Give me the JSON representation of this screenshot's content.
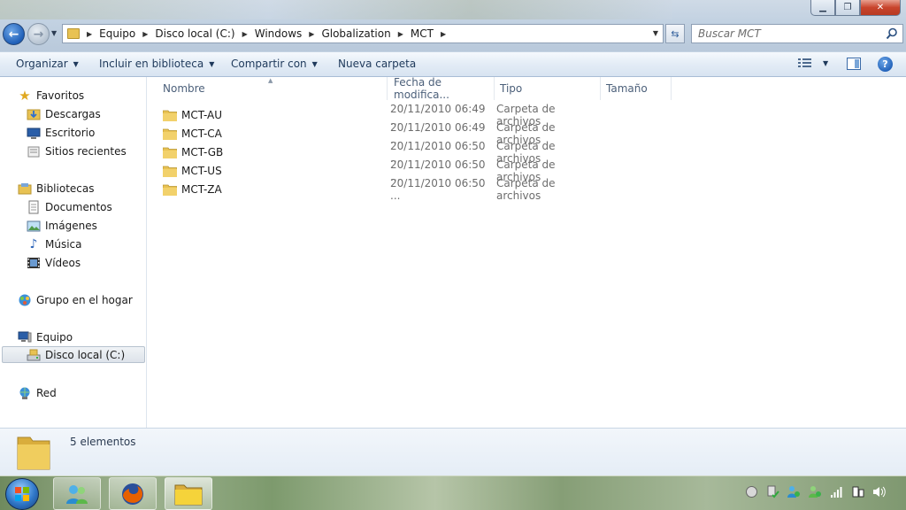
{
  "address_bar": {
    "crumbs": [
      "Equipo",
      "Disco local (C:)",
      "Windows",
      "Globalization",
      "MCT"
    ]
  },
  "search": {
    "placeholder": "Buscar MCT"
  },
  "toolbar": {
    "organize": "Organizar",
    "include_library": "Incluir en biblioteca",
    "share_with": "Compartir con",
    "new_folder": "Nueva carpeta"
  },
  "nav": {
    "favorites": "Favoritos",
    "downloads": "Descargas",
    "desktop": "Escritorio",
    "recent": "Sitios recientes",
    "libraries": "Bibliotecas",
    "documents": "Documentos",
    "images": "Imágenes",
    "music": "Música",
    "videos": "Vídeos",
    "homegroup": "Grupo en el hogar",
    "computer": "Equipo",
    "local_disk": "Disco local (C:)",
    "network": "Red"
  },
  "columns": {
    "name": "Nombre",
    "date": "Fecha de modifica...",
    "type": "Tipo",
    "size": "Tamaño"
  },
  "files": [
    {
      "name": "MCT-AU",
      "date": "20/11/2010 06:49 ...",
      "type": "Carpeta de archivos"
    },
    {
      "name": "MCT-CA",
      "date": "20/11/2010 06:49 ...",
      "type": "Carpeta de archivos"
    },
    {
      "name": "MCT-GB",
      "date": "20/11/2010 06:50 ...",
      "type": "Carpeta de archivos"
    },
    {
      "name": "MCT-US",
      "date": "20/11/2010 06:50 ...",
      "type": "Carpeta de archivos"
    },
    {
      "name": "MCT-ZA",
      "date": "20/11/2010 06:50 ...",
      "type": "Carpeta de archivos"
    }
  ],
  "details": {
    "count": "5 elementos"
  },
  "colors": {
    "folder": "#e8c253",
    "accent": "#1e395b",
    "selection": "#dde3ea"
  }
}
